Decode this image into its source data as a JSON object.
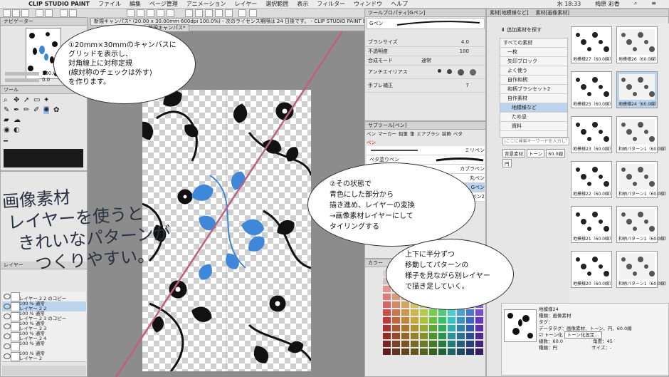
{
  "menubar": {
    "app": "CLIP STUDIO PAINT",
    "items": [
      "ファイル",
      "編集",
      "ページ管理",
      "アニメーション",
      "レイヤー",
      "選択範囲",
      "表示",
      "フィルター",
      "ウィンドウ",
      "ヘルプ"
    ],
    "clock": "水 18:33",
    "user": "梅原 彩香"
  },
  "canvas": {
    "tab_title": "新規キャンパス* (20.00 x 30.00mm 600dpi 100.0%)",
    "license_notice": "- 次のライセンス期限は 24 日後です。 - CLIP STUDIO PAINT EX",
    "tab2": "新規キャンパス*"
  },
  "navigator": {
    "title": "ナビゲーター",
    "zoom": "100.0",
    "angle": "0.0"
  },
  "tool_panel": {
    "title": "ツール"
  },
  "tool_property": {
    "title": "ツールプロパティ[Gペン]",
    "tool_name": "Gペン",
    "brush_size_label": "ブラシサイズ",
    "brush_size": "4.0",
    "opacity_label": "不透明度",
    "opacity": "100",
    "blend_label": "合成モード",
    "blend": "通常",
    "aa_label": "アンチエイリアス",
    "correction_label": "手ブレ補正",
    "correction": "7"
  },
  "subtool": {
    "title": "サブツール[ペン]",
    "tabs": [
      "ペン",
      "マーカー",
      "鉛筆",
      "筆",
      "エアブラシ",
      "装飾",
      "ベタ"
    ],
    "group": "ペン",
    "items": [
      "ミリペン",
      "ベタ塗りペン",
      "カブラペン",
      "丸ペン",
      "Gペン",
      "ガーペン2"
    ]
  },
  "material": {
    "title": "素材[地模様など]",
    "tab2": "素材[画像素材]",
    "add_button": "追加素材を探す",
    "tree": [
      "すべての素材",
      "一枚",
      "矢印ブロック",
      "よく使う",
      "自作和柄",
      "和柄ブラシセット2",
      "自作素材",
      "地模様など",
      "ため息",
      "資料"
    ],
    "search_placeholder": "[ここに検索キーワードを入力してくだ",
    "tags": [
      "背景素材",
      "トーン",
      "60.0線",
      "円"
    ],
    "thumbs": [
      "地模様27（60.0線）",
      "地模様26（60.0線）",
      "地模様25（60.0線）",
      "地模様24（60.0線）",
      "地模様23（60.0線）",
      "和柄パターン1（60.0線）",
      "地模様22（60.0線）",
      "和柄パターン1（60.0線）",
      "地模様21（60.0線）",
      "和柄パターン1（60.0線）",
      "地模様20（60.0線）",
      "和柄パターン1（60.0線）"
    ],
    "detail_name": "地模様24",
    "detail_kind": "種類：画像素材",
    "detail_tags": "タグ：",
    "detail_datatag": "データタグ：画像素材、トーン、円、60.0線",
    "detail_tone": "トーン化",
    "detail_tone_button": "トーン化設定...",
    "detail_lines": "線数：60.0",
    "detail_angle": "角度：45",
    "detail_shape": "種類：円",
    "detail_size": "サイズ：-"
  },
  "layers": {
    "title": "レイヤー",
    "rows": [
      {
        "pct": "",
        "name": "レイヤー 2 2 のコピー"
      },
      {
        "pct": "100 % 通常",
        "name": "レイヤー 2 2"
      },
      {
        "pct": "100 % 通常",
        "name": "レイヤー 2 3 のコピー"
      },
      {
        "pct": "100 % 通常",
        "name": "レイヤー 2 3"
      },
      {
        "pct": "100 % 通常",
        "name": "レイヤー 2 4"
      },
      {
        "pct": "100 % 通常",
        "name": ""
      },
      {
        "pct": "100 % 通常",
        "name": "レイヤー 2"
      }
    ]
  },
  "color_set": {
    "title": "カラー"
  },
  "notes": {
    "bubble1": [
      "①20mm×30mmのキャンバスに",
      "グリッドを表示し、",
      "対角線上に対称定規",
      "(線対称のチェックは外す)",
      "を作ります。"
    ],
    "bubble2": [
      "②その状態で",
      "青色にした部分から",
      "描き進め、レイヤーの変換",
      "→画像素材レイヤーにして",
      "タイリングする"
    ],
    "note3": [
      "上下に半分ずつ",
      "移動してパターンの",
      "様子を見ながら別レイヤー",
      "で描き足していく。"
    ],
    "handwritten": [
      "画像素材",
      "レイヤーを使うと",
      "きれいなパターンが",
      "つくりやすい。"
    ]
  },
  "colors": {
    "accent_blue": "#3f88d9",
    "ruler_line": "#c06080"
  }
}
